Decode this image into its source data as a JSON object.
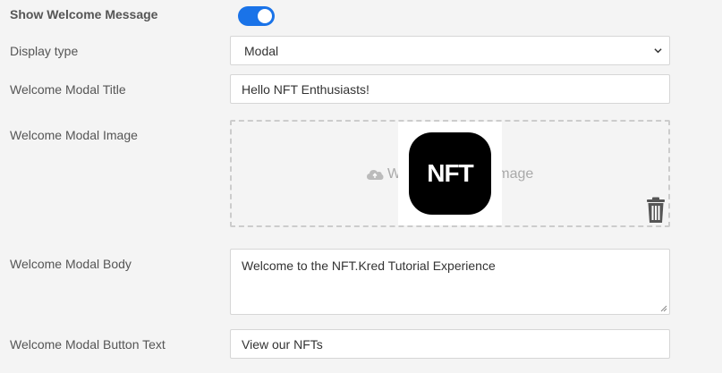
{
  "settings": {
    "show_welcome": {
      "label": "Show Welcome Message",
      "enabled": true
    },
    "display_type": {
      "label": "Display type",
      "value": "Modal"
    },
    "modal_title": {
      "label": "Welcome Modal Title",
      "value": "Hello NFT Enthusiasts!"
    },
    "modal_image": {
      "label": "Welcome Modal Image",
      "hint": "Welcome Modal Image",
      "preview_text": "NFT",
      "icons": {
        "upload": "cloud-upload-icon",
        "delete": "trash-icon"
      }
    },
    "modal_body": {
      "label": "Welcome Modal Body",
      "value": "Welcome to the NFT.Kred Tutorial Experience"
    },
    "button_text": {
      "label": "Welcome Modal Button Text",
      "value": "View our NFTs"
    }
  },
  "colors": {
    "accent": "#1a73e8",
    "background": "#f4f4f4",
    "label": "#555555"
  }
}
